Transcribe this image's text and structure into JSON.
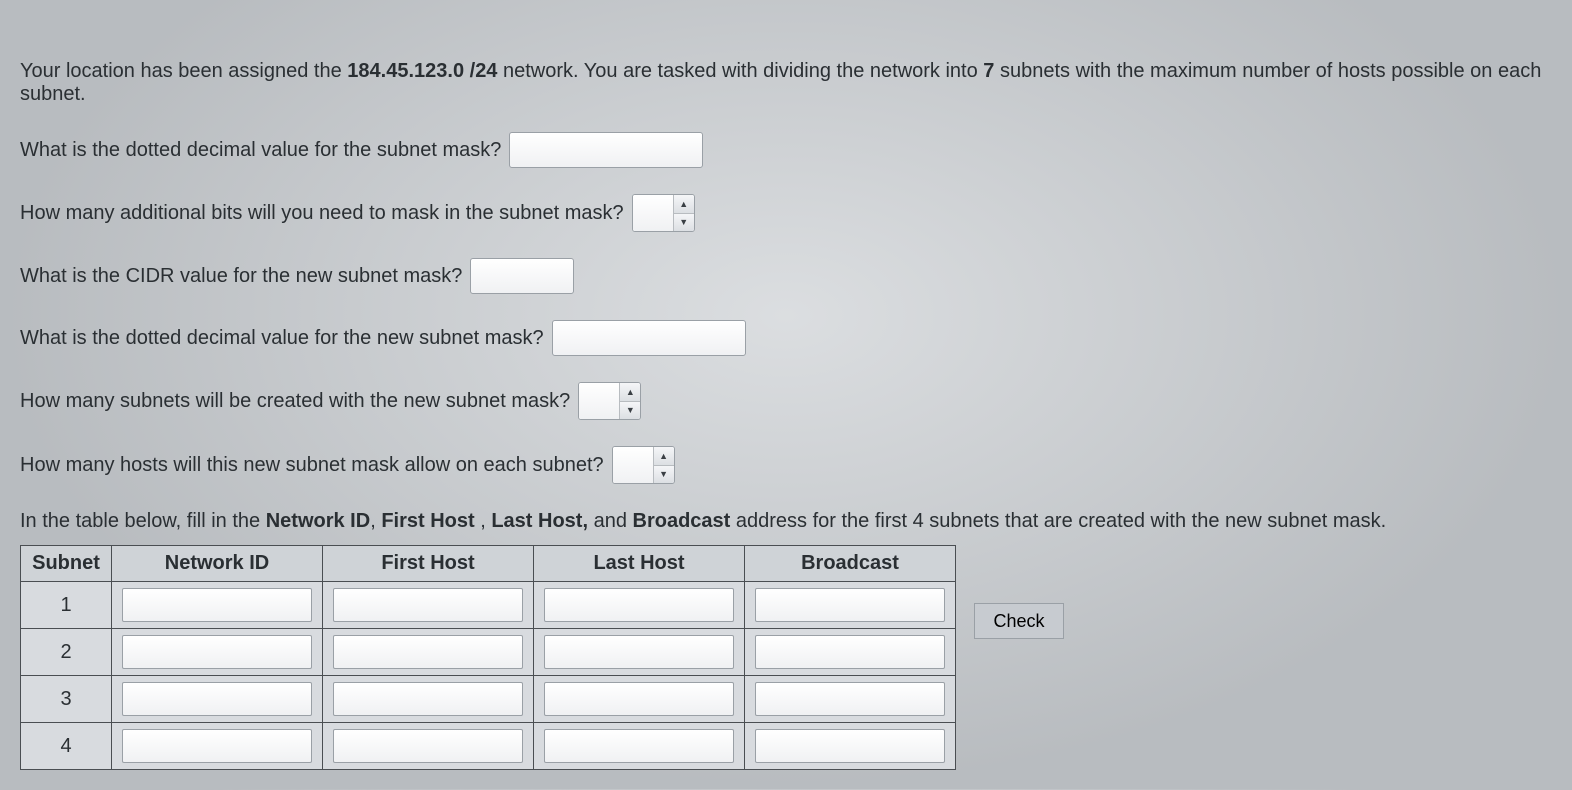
{
  "intro": {
    "prefix": "Your location has been assigned the ",
    "network_bold": "184.45.123.0 /24",
    "mid1": " network.  You are tasked with dividing the network into ",
    "subnets_bold": "7",
    "suffix": " subnets with the maximum number of hosts possible on each subnet."
  },
  "questions": {
    "q1_label": "What is the dotted decimal value for the subnet mask?",
    "q1_value": "",
    "q2_label": "How many additional bits will you need to mask in the subnet mask?",
    "q2_value": "",
    "q3_label": "What is the CIDR value for the new subnet mask?",
    "q3_value": "",
    "q4_label": "What is the dotted decimal value for the new subnet mask?",
    "q4_value": "",
    "q5_label": "How many subnets will be created with the new subnet mask?",
    "q5_value": "",
    "q6_label": "How many hosts will this new subnet mask allow on each subnet?",
    "q6_value": ""
  },
  "table_instr": {
    "prefix": "In the table below, fill in the ",
    "b1": "Network ID",
    "sep1": ", ",
    "b2": "First Host",
    "sep2": " , ",
    "b3": "Last Host,",
    "sep3": " and ",
    "b4": "Broadcast",
    "suffix": " address for the first 4 subnets that are created with the new subnet mask."
  },
  "table": {
    "headers": {
      "subnet": "Subnet",
      "network_id": "Network ID",
      "first_host": "First Host",
      "last_host": "Last Host",
      "broadcast": "Broadcast"
    },
    "rows": [
      {
        "num": "1",
        "network_id": "",
        "first_host": "",
        "last_host": "",
        "broadcast": ""
      },
      {
        "num": "2",
        "network_id": "",
        "first_host": "",
        "last_host": "",
        "broadcast": ""
      },
      {
        "num": "3",
        "network_id": "",
        "first_host": "",
        "last_host": "",
        "broadcast": ""
      },
      {
        "num": "4",
        "network_id": "",
        "first_host": "",
        "last_host": "",
        "broadcast": ""
      }
    ]
  },
  "buttons": {
    "check": "Check"
  },
  "icons": {
    "up": "▲",
    "down": "▼"
  }
}
